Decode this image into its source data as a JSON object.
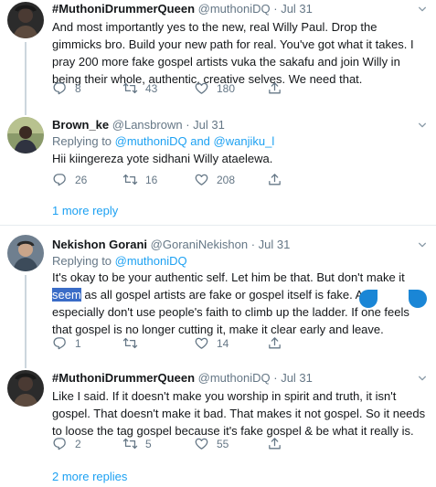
{
  "tweets": [
    {
      "name": "#MuthoniDrummerQueen",
      "handle": "@muthoniDQ",
      "dot": "·",
      "time": "Jul 31",
      "text": "And most importantly yes to the new, real Willy Paul. Drop the gimmicks bro. Build your new path for real. You've got what it takes. I pray 200 more fake gospel artists vuka the sakafu and join Willy in being their whole, authentic, creative selves. We need that.",
      "replies": "8",
      "retweets": "43",
      "likes": "180"
    },
    {
      "name": "Brown_ke",
      "handle": "@Lansbrown",
      "dot": "·",
      "time": "Jul 31",
      "replying_prefix": "Replying to ",
      "replying_user1": "@muthoniDQ",
      "replying_and": " and ",
      "replying_user2": "@wanjiku_l",
      "text": "Hii kiingereza yote sidhani Willy ataelewa.",
      "replies": "26",
      "retweets": "16",
      "likes": "208"
    },
    {
      "name": "Nekishon Gorani",
      "handle": "@GoraniNekishon",
      "dot": "·",
      "time": "Jul 31",
      "replying_prefix": "Replying to ",
      "replying_user1": "@muthoniDQ",
      "text_before": "It's okay to be your authentic self. Let him be that. But don't make it ",
      "text_selected": "seem",
      "text_after": " as all gospel artists are fake or gospel itself is fake. And especially don't use people's faith to climb up the ladder. If one feels that gospel is no longer cutting it, make it clear early and leave.",
      "replies": "1",
      "retweets": "",
      "likes": "14"
    },
    {
      "name": "#MuthoniDrummerQueen",
      "handle": "@muthoniDQ",
      "dot": "·",
      "time": "Jul 31",
      "text": "Like I said. If it doesn't make you worship in spirit and truth, it isn't gospel. That doesn't make it bad. That makes it not gospel. So it needs to loose the tag gospel because it's fake gospel & be what it really is.",
      "replies": "2",
      "retweets": "5",
      "likes": "55"
    }
  ],
  "more_replies_1": "1 more reply",
  "more_replies_2": "2 more replies",
  "icons": [
    "reply-icon",
    "retweet-icon",
    "like-icon",
    "share-icon",
    "chevron-down-icon"
  ],
  "colors": {
    "link": "#1da1f2",
    "muted": "#657786",
    "selection": "#3a6cc7"
  }
}
